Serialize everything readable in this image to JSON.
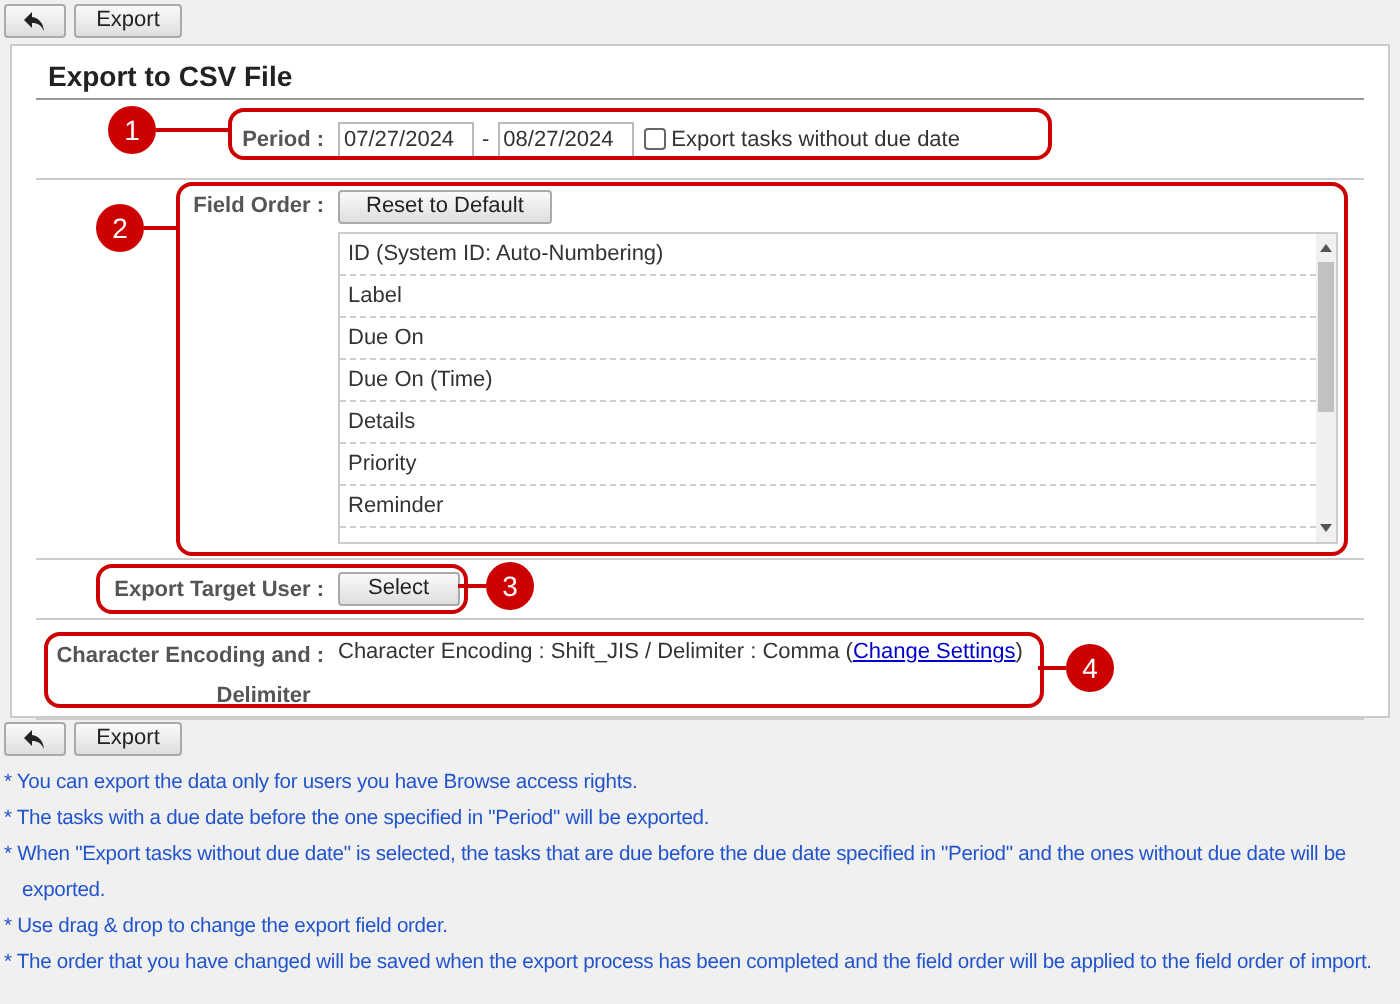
{
  "top_toolbar": {
    "export_button": "Export"
  },
  "title": "Export to CSV File",
  "period": {
    "label": "Period",
    "separator": ":",
    "from": "07/27/2024",
    "dash": "-",
    "to": "08/27/2024",
    "without_due": {
      "label": "Export tasks without due date",
      "checked": false
    },
    "callout": "1"
  },
  "field_order": {
    "label": "Field Order",
    "separator": ":",
    "reset_button": "Reset to Default",
    "callout": "2",
    "items": [
      {
        "label": "ID (System ID: Auto-Numbering)"
      },
      {
        "label": "Label"
      },
      {
        "label": "Due On"
      },
      {
        "label": "Due On (Time)"
      },
      {
        "label": "Details"
      },
      {
        "label": "Priority"
      },
      {
        "label": "Reminder"
      }
    ]
  },
  "target_user": {
    "label": "Export Target User",
    "separator": ":",
    "select_button": "Select",
    "callout": "3"
  },
  "encoding": {
    "label_lines": [
      "Character Encoding and",
      "Delimiter"
    ],
    "separator": ":",
    "encoding_label": "Character Encoding",
    "encoding_sep": ":",
    "value": "Shift_JIS / Delimiter",
    "delim_sep": ":",
    "delimiter": "Comma (",
    "link": "Change Settings",
    "close": ")",
    "callout": "4"
  },
  "bottom_toolbar": {
    "export_button": "Export"
  },
  "notes": [
    "* You can export the data only for users you have Browse access rights.",
    "* The tasks with a due date before the one specified in \"Period\" will be exported.",
    "* When \"Export tasks without due date\" is selected, the tasks that are due before the due date specified in \"Period\" and the ones without due date will be exported.",
    "* Use drag & drop to change the export field order.",
    "* The order that you have changed will be saved when the export process has been completed and the field order will be applied to the field order of import."
  ]
}
